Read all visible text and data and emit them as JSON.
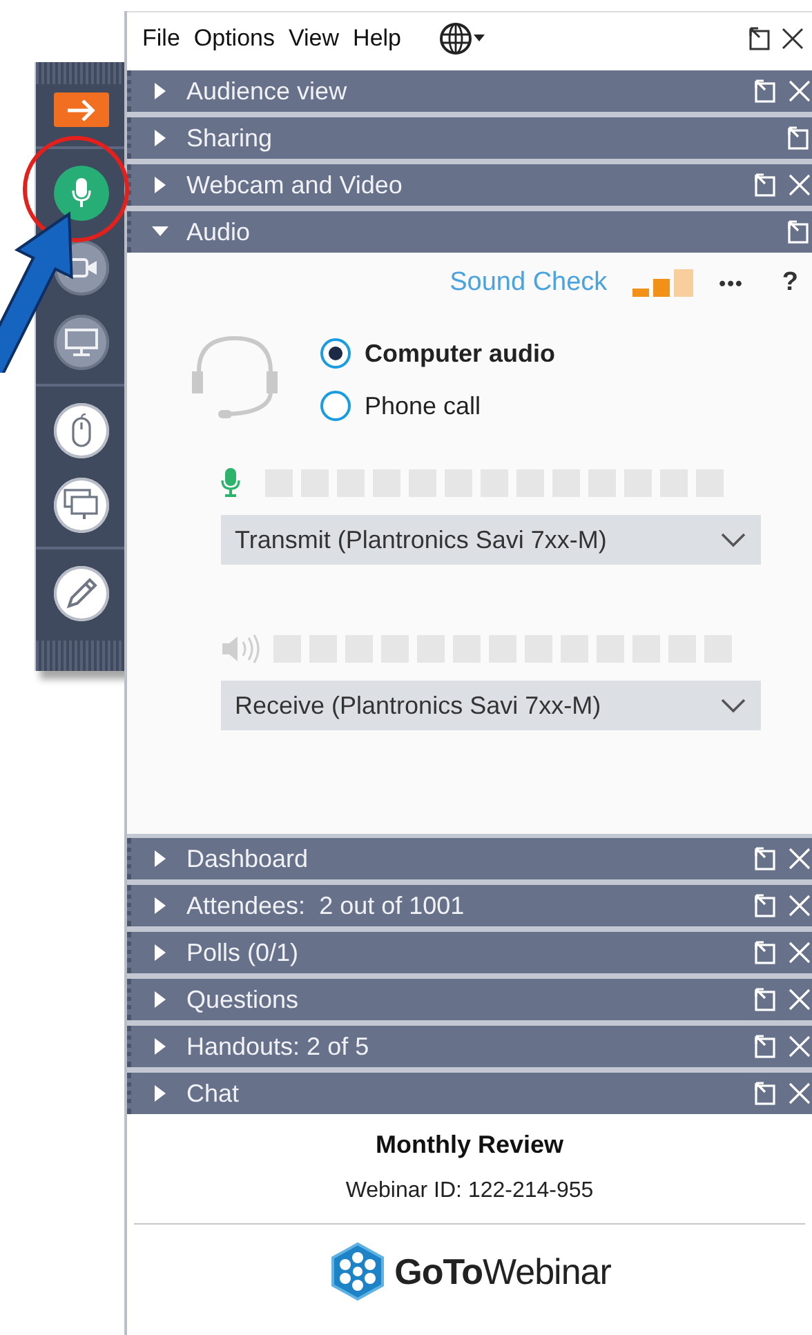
{
  "toolbar": [
    {
      "kind": "arrow",
      "on": false
    },
    {
      "kind": "mic",
      "on": true
    },
    {
      "kind": "webcam",
      "on": false
    },
    {
      "kind": "screen",
      "on": false
    },
    {
      "kind": "mouse",
      "on": false
    },
    {
      "kind": "windows",
      "on": false
    },
    {
      "kind": "pen",
      "on": false
    }
  ],
  "menu": [
    "File",
    "Options",
    "View",
    "Help"
  ],
  "panels_top": [
    {
      "title": "Audience view",
      "expanded": false,
      "closable": true
    },
    {
      "title": "Sharing",
      "expanded": false,
      "closable": false
    },
    {
      "title": "Webcam and Video",
      "expanded": false,
      "closable": true
    },
    {
      "title": "Audio",
      "expanded": true,
      "closable": false
    }
  ],
  "audio": {
    "sound_check": "Sound Check",
    "more": "•••",
    "help": "?",
    "options": [
      {
        "label": "Computer audio",
        "selected": true
      },
      {
        "label": "Phone call",
        "selected": false
      }
    ],
    "transmit": "Transmit (Plantronics Savi 7xx-M)",
    "receive": "Receive (Plantronics Savi 7xx-M)"
  },
  "panels_bottom": [
    {
      "title": "Dashboard",
      "expanded": false,
      "closable": true
    },
    {
      "title": "Attendees:  2 out of 1001",
      "expanded": false,
      "closable": true
    },
    {
      "title": "Polls (0/1)",
      "expanded": false,
      "closable": true
    },
    {
      "title": "Questions",
      "expanded": false,
      "closable": true
    },
    {
      "title": "Handouts: 2 of 5",
      "expanded": false,
      "closable": true
    },
    {
      "title": "Chat",
      "expanded": false,
      "closable": true
    }
  ],
  "footer": {
    "title": "Monthly Review",
    "webinar_id": "Webinar ID: 122-214-955",
    "logo": "**GoTo**Webinar"
  }
}
